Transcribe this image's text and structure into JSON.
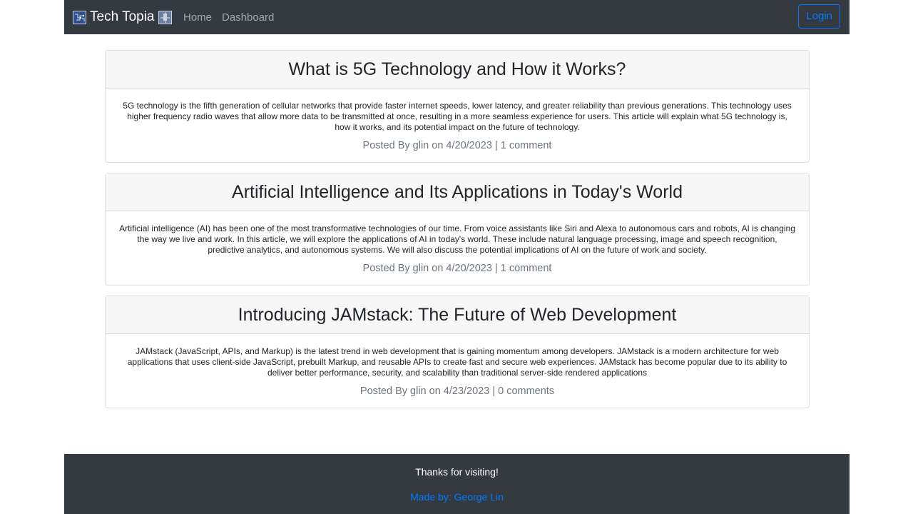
{
  "navbar": {
    "brand": "Tech Topia",
    "brand_icon_left": "circuit-image-icon",
    "brand_icon_right": "tech-image-icon",
    "links": [
      "Home",
      "Dashboard"
    ],
    "login_label": "Login"
  },
  "posts": [
    {
      "title": "What is 5G Technology and How it Works?",
      "body": "5G technology is the fifth generation of cellular networks that provide faster internet speeds, lower latency, and greater reliability than previous generations. This technology uses higher frequency radio waves that allow more data to be transmitted at once, resulting in a more seamless experience for users. This article will explain what 5G technology is, how it works, and its potential impact on the future of technology.",
      "meta": "Posted By glin on 4/20/2023 | 1 comment"
    },
    {
      "title": "Artificial Intelligence and Its Applications in Today's World",
      "body": "Artificial intelligence (AI) has been one of the most transformative technologies of our time. From voice assistants like Siri and Alexa to autonomous cars and robots, AI is changing the way we live and work. In this article, we will explore the applications of AI in today's world. These include natural language processing, image and speech recognition, predictive analytics, and autonomous systems. We will also discuss the potential implications of AI on the future of work and society.",
      "meta": "Posted By glin on 4/20/2023 | 1 comment"
    },
    {
      "title": "Introducing JAMstack: The Future of Web Development",
      "body": "JAMstack (JavaScript, APIs, and Markup) is the latest trend in web development that is gaining momentum among developers. JAMstack is a modern architecture for web applications that uses client-side JavaScript, prebuilt Markup, and reusable APIs to create fast and secure web experiences. JAMstack has become popular due to its ability to deliver better performance, security, and scalability than traditional server-side rendered applications",
      "meta": "Posted By glin on 4/23/2023 | 0 comments"
    }
  ],
  "footer": {
    "thanks": "Thanks for visiting!",
    "author": "Made by: George Lin"
  },
  "colors": {
    "navbar_bg": "#343a40",
    "link_blue": "#007bff",
    "card_header_bg": "#f7f7f7",
    "meta_gray": "#6c757d"
  }
}
